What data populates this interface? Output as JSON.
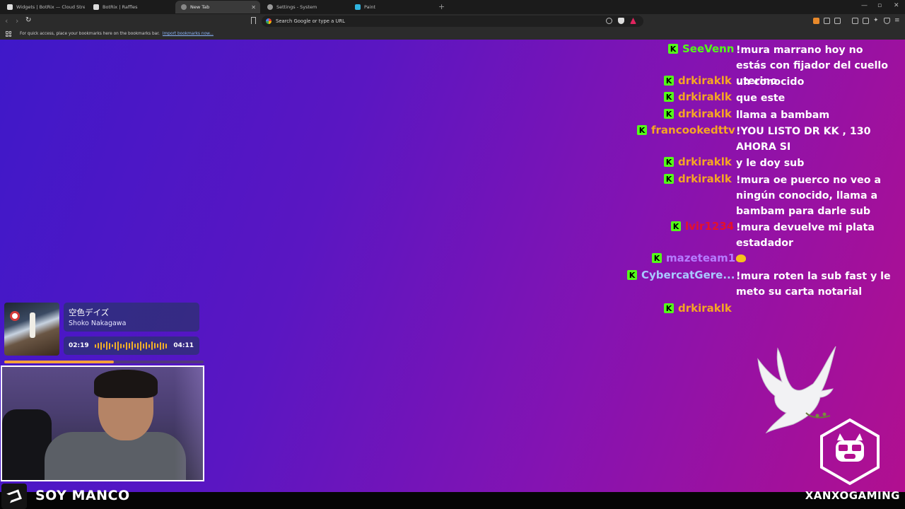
{
  "browser": {
    "tabs": [
      {
        "label": "Widgets | BotRix — Cloud Streaming",
        "icon": "botrix-icon",
        "active": false
      },
      {
        "label": "BotRix | Raffles",
        "icon": "botrix-icon",
        "active": false
      },
      {
        "label": "New Tab",
        "icon": "newtab-icon",
        "active": true
      },
      {
        "label": "Settings - System",
        "icon": "gear-icon",
        "active": false
      },
      {
        "label": "Paint",
        "icon": "paint-icon",
        "active": false
      }
    ],
    "new_tab": "+",
    "omnibox_placeholder": "Search Google or type a URL",
    "bookmarks_message": "For quick access, place your bookmarks here on the bookmarks bar.",
    "bookmarks_link": "Import bookmarks now..."
  },
  "chat": {
    "messages": [
      {
        "user": "SeeVenn",
        "color": "#53fc18",
        "text": "!mura marrano hoy no estás con fijador del cuello uterino"
      },
      {
        "user": "drkiraklk",
        "color": "#f5a623",
        "text": "un conocido"
      },
      {
        "user": "drkiraklk",
        "color": "#f5a623",
        "text": "que este"
      },
      {
        "user": "drkiraklk",
        "color": "#f5a623",
        "text": "llama a bambam"
      },
      {
        "user": "francookedttv",
        "color": "#f5a623",
        "text": "!YOU LISTO DR KK , 130 AHORA SI"
      },
      {
        "user": "drkiraklk",
        "color": "#f5a623",
        "text": "y le doy sub"
      },
      {
        "user": "drkiraklk",
        "color": "#f5a623",
        "text": "!mura oe puerco no veo a ningún conocido, llama a bambam para darle sub"
      },
      {
        "user": "lvir1234",
        "color": "#e4112c",
        "text": "!mura devuelve mi plata estadador"
      },
      {
        "user": "mazeteam1",
        "color": "#b57cff",
        "text": ""
      },
      {
        "user": "CybercatGere...",
        "color": "#a9c8ff",
        "text": "!mura roten la sub fast y le meto su carta notarial"
      },
      {
        "user": "drkiraklk",
        "color": "#f5a623",
        "text": ""
      }
    ],
    "badge_letter": "K"
  },
  "music": {
    "title": "空色デイズ",
    "artist": "Shoko Nakagawa",
    "current_time": "02:19",
    "total_time": "04:11",
    "progress": 0.55
  },
  "overlay": {
    "brand_left": "SOY MANCO",
    "brand_right": "XANXOGAMING"
  }
}
